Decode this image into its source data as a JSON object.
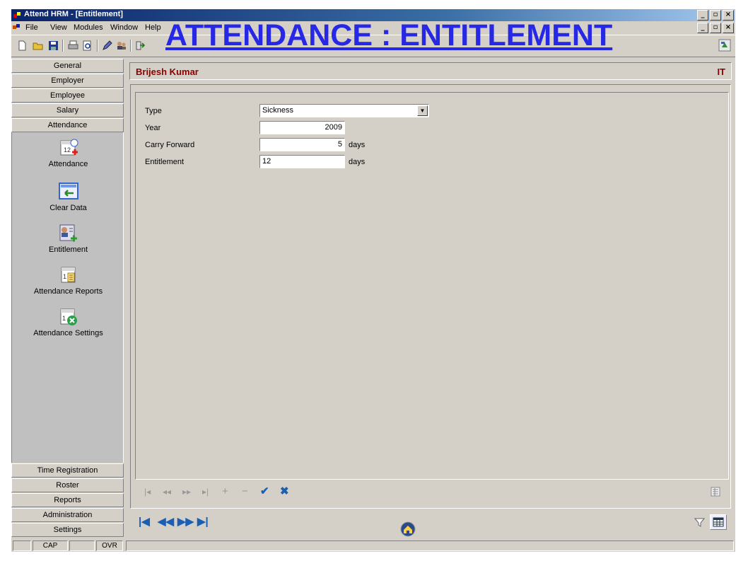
{
  "window": {
    "title": "Attend HRM - [Entitlement]"
  },
  "banner": "ATTENDANCE : ENTITLEMENT",
  "menu": [
    "File",
    "View",
    "Modules",
    "Window",
    "Help"
  ],
  "nav": {
    "top_groups": [
      "General",
      "Employer",
      "Employee",
      "Salary",
      "Attendance"
    ],
    "attendance_items": [
      {
        "label": "Attendance",
        "icon": "calendar-add-icon"
      },
      {
        "label": "Clear Data",
        "icon": "clear-data-icon"
      },
      {
        "label": "Entitlement",
        "icon": "entitlement-icon"
      },
      {
        "label": "Attendance Reports",
        "icon": "report-icon"
      },
      {
        "label": "Attendance Settings",
        "icon": "settings-icon"
      }
    ],
    "bottom_groups": [
      "Time Registration",
      "Roster",
      "Reports",
      "Administration",
      "Settings"
    ]
  },
  "header": {
    "employee_name": "Brijesh Kumar",
    "department": "IT"
  },
  "form": {
    "type_label": "Type",
    "type_value": "Sickness",
    "year_label": "Year",
    "year_value": "2009",
    "carry_label": "Carry Forward",
    "carry_value": "5",
    "carry_unit": "days",
    "ent_label": "Entitlement",
    "ent_value": "12",
    "ent_unit": "days"
  },
  "status": {
    "cap": "CAP",
    "ovr": "OVR"
  },
  "colors": {
    "accent_blue": "#2727e6",
    "header_text": "#8b0000"
  }
}
